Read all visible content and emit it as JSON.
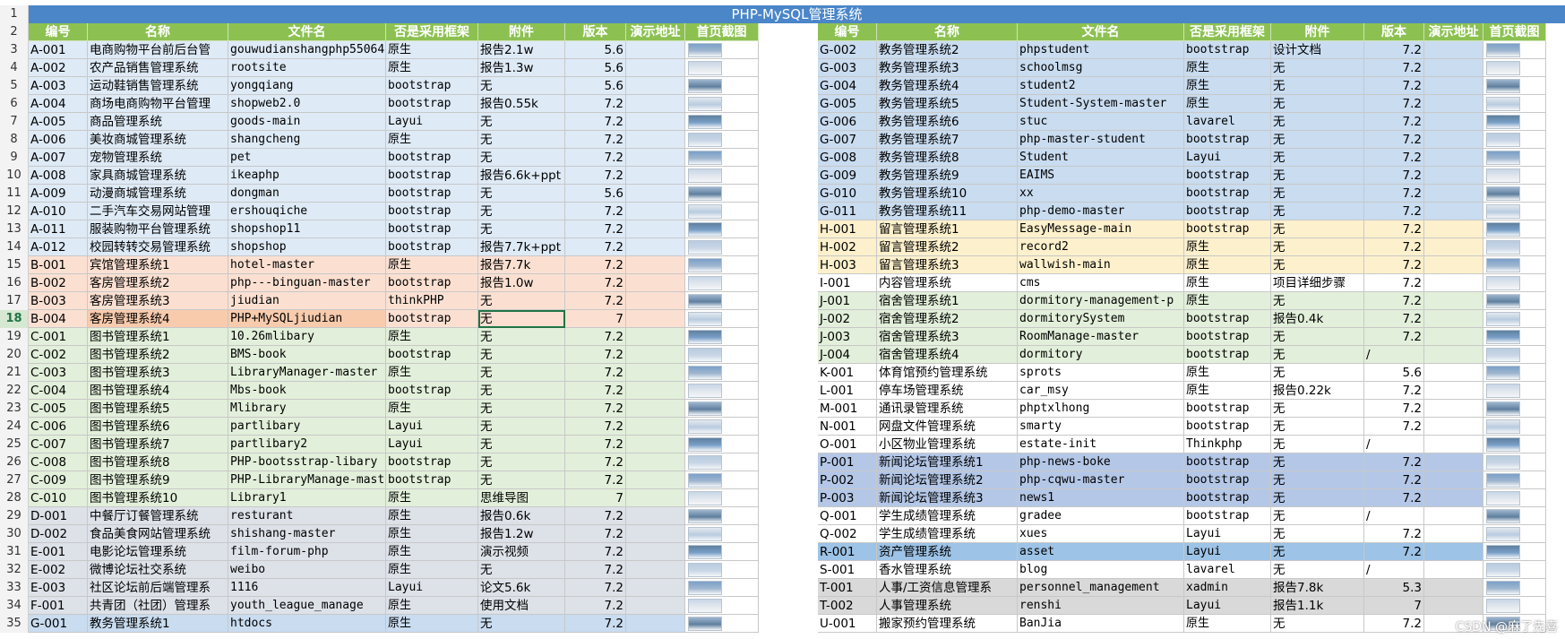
{
  "banner": "PHP-MySQL管理系统",
  "headers": [
    "编号",
    "名称",
    "文件名",
    "否是采用框架",
    "附件",
    "版本",
    "演示地址",
    "首页截图"
  ],
  "colors": {
    "header_green": "#8cc152",
    "banner_blue": "#4a86c8",
    "A": "#deeaf6",
    "B": "#fbe0d2",
    "C": "#e2efda",
    "D": "#dde1e8",
    "G": "#c9dcf0",
    "H": "#fdf0cc",
    "J": "#e2efda",
    "P": "#b4c7e7",
    "R": "#9dc3e6",
    "T": "#d9d9d9",
    "plain": "#ffffff"
  },
  "left_rows": [
    {
      "row": "3",
      "id": "A-001",
      "name": "电商购物平台前后台管",
      "file": "gouwudianshangphp55064",
      "fw": "原生",
      "att": "报告2.1w",
      "ver": "5.6",
      "g": "A"
    },
    {
      "row": "4",
      "id": "A-002",
      "name": "农产品销售管理系统",
      "file": "rootsite",
      "fw": "原生",
      "att": "报告1.3w",
      "ver": "5.6",
      "g": "A"
    },
    {
      "row": "5",
      "id": "A-003",
      "name": "运动鞋销售管理系统",
      "file": "yongqiang",
      "fw": "bootstrap",
      "att": "无",
      "ver": "5.6",
      "g": "A"
    },
    {
      "row": "6",
      "id": "A-004",
      "name": "商场电商购物平台管理",
      "file": "shopweb2.0",
      "fw": "bootstrap",
      "att": "报告0.55k",
      "ver": "7.2",
      "g": "A"
    },
    {
      "row": "7",
      "id": "A-005",
      "name": "商品管理系统",
      "file": "goods-main",
      "fw": "Layui",
      "att": "无",
      "ver": "7.2",
      "g": "A"
    },
    {
      "row": "8",
      "id": "A-006",
      "name": "美妆商城管理系统",
      "file": "shangcheng",
      "fw": "原生",
      "att": "无",
      "ver": "7.2",
      "g": "A"
    },
    {
      "row": "9",
      "id": "A-007",
      "name": "宠物管理系统",
      "file": "pet",
      "fw": "bootstrap",
      "att": "无",
      "ver": "7.2",
      "g": "A"
    },
    {
      "row": "10",
      "id": "A-008",
      "name": "家具商城管理系统",
      "file": "ikeaphp",
      "fw": "bootstrap",
      "att": "报告6.6k+ppt",
      "ver": "7.2",
      "g": "A"
    },
    {
      "row": "11",
      "id": "A-009",
      "name": "动漫商城管理系统",
      "file": "dongman",
      "fw": "bootstrap",
      "att": "无",
      "ver": "5.6",
      "g": "A"
    },
    {
      "row": "12",
      "id": "A-010",
      "name": "二手汽车交易网站管理",
      "file": "ershouqiche",
      "fw": "bootstrap",
      "att": "无",
      "ver": "7.2",
      "g": "A"
    },
    {
      "row": "13",
      "id": "A-011",
      "name": "服装购物平台管理系统",
      "file": "shopshop11",
      "fw": "bootstrap",
      "att": "无",
      "ver": "7.2",
      "g": "A"
    },
    {
      "row": "14",
      "id": "A-012",
      "name": "校园转转交易管理系统",
      "file": "shopshop",
      "fw": "bootstrap",
      "att": "报告7.7k+ppt",
      "ver": "7.2",
      "g": "A"
    },
    {
      "row": "15",
      "id": "B-001",
      "name": "宾馆管理系统1",
      "file": "hotel-master",
      "fw": "原生",
      "att": "报告7.7k",
      "ver": "7.2",
      "g": "B"
    },
    {
      "row": "16",
      "id": "B-002",
      "name": "客房管理系统2",
      "file": "php---binguan-master",
      "fw": "bootstrap",
      "att": "报告1.0w",
      "ver": "7.2",
      "g": "B"
    },
    {
      "row": "17",
      "id": "B-003",
      "name": "客房管理系统3",
      "file": "jiudian",
      "fw": "thinkPHP",
      "att": "无",
      "ver": "7.2",
      "g": "B"
    },
    {
      "row": "18",
      "id": "B-004",
      "name": "客房管理系统4",
      "file": "PHP+MySQLjiudian",
      "fw": "bootstrap",
      "att": "无",
      "ver": "7",
      "g": "B"
    },
    {
      "row": "19",
      "id": "C-001",
      "name": "图书管理系统1",
      "file": "10.26mlibary",
      "fw": "原生",
      "att": "无",
      "ver": "7.2",
      "g": "C"
    },
    {
      "row": "20",
      "id": "C-002",
      "name": "图书管理系统2",
      "file": "BMS-book",
      "fw": "bootstrap",
      "att": "无",
      "ver": "7.2",
      "g": "C"
    },
    {
      "row": "21",
      "id": "C-003",
      "name": "图书管理系统3",
      "file": "LibraryManager-master",
      "fw": "原生",
      "att": "无",
      "ver": "7.2",
      "g": "C"
    },
    {
      "row": "22",
      "id": "C-004",
      "name": "图书管理系统4",
      "file": "Mbs-book",
      "fw": "bootstrap",
      "att": "无",
      "ver": "7.2",
      "g": "C"
    },
    {
      "row": "23",
      "id": "C-005",
      "name": "图书管理系统5",
      "file": "Mlibrary",
      "fw": "原生",
      "att": "无",
      "ver": "7.2",
      "g": "C"
    },
    {
      "row": "24",
      "id": "C-006",
      "name": "图书管理系统6",
      "file": "partlibary",
      "fw": "Layui",
      "att": "无",
      "ver": "7.2",
      "g": "C"
    },
    {
      "row": "25",
      "id": "C-007",
      "name": "图书管理系统7",
      "file": "partlibary2",
      "fw": "Layui",
      "att": "无",
      "ver": "7.2",
      "g": "C"
    },
    {
      "row": "26",
      "id": "C-008",
      "name": "图书管理系统8",
      "file": "PHP-bootsstrap-libary",
      "fw": "bootstrap",
      "att": "无",
      "ver": "7.2",
      "g": "C"
    },
    {
      "row": "27",
      "id": "C-009",
      "name": "图书管理系统9",
      "file": "PHP-LibraryManage-mast",
      "fw": "bootstrap",
      "att": "无",
      "ver": "7.2",
      "g": "C"
    },
    {
      "row": "28",
      "id": "C-010",
      "name": "图书管理系统10",
      "file": "Library1",
      "fw": "原生",
      "att": "思维导图",
      "ver": "7",
      "g": "C"
    },
    {
      "row": "29",
      "id": "D-001",
      "name": "中餐厅订餐管理系统",
      "file": "resturant",
      "fw": "原生",
      "att": "报告0.6k",
      "ver": "7.2",
      "g": "D"
    },
    {
      "row": "30",
      "id": "D-002",
      "name": "食品美食网站管理系统",
      "file": "shishang-master",
      "fw": "原生",
      "att": "报告1.2w",
      "ver": "7.2",
      "g": "D"
    },
    {
      "row": "31",
      "id": "E-001",
      "name": "电影论坛管理系统",
      "file": "film-forum-php",
      "fw": "原生",
      "att": "演示视频",
      "ver": "7.2",
      "g": "D"
    },
    {
      "row": "32",
      "id": "E-002",
      "name": "微博论坛社交系统",
      "file": "weibo",
      "fw": "原生",
      "att": "无",
      "ver": "7.2",
      "g": "D"
    },
    {
      "row": "33",
      "id": "E-003",
      "name": "社区论坛前后端管理系",
      "file": "1116",
      "fw": "Layui",
      "att": "论文5.6k",
      "ver": "7.2",
      "g": "D"
    },
    {
      "row": "34",
      "id": "F-001",
      "name": "共青团（社团）管理系",
      "file": "youth_league_manage",
      "fw": "原生",
      "att": "使用文档",
      "ver": "7.2",
      "g": "D"
    },
    {
      "row": "35",
      "id": "G-001",
      "name": "教务管理系统1",
      "file": "htdocs",
      "fw": "原生",
      "att": "无",
      "ver": "7.2",
      "g": "G"
    }
  ],
  "right_rows": [
    {
      "id": "G-002",
      "name": "教务管理系统2",
      "file": "phpstudent",
      "fw": "bootstrap",
      "att": "设计文档",
      "ver": "7.2",
      "g": "G"
    },
    {
      "id": "G-003",
      "name": "教务管理系统3",
      "file": "schoolmsg",
      "fw": "原生",
      "att": "无",
      "ver": "7.2",
      "g": "G"
    },
    {
      "id": "G-004",
      "name": "教务管理系统4",
      "file": "student2",
      "fw": "原生",
      "att": "无",
      "ver": "7.2",
      "g": "G"
    },
    {
      "id": "G-005",
      "name": "教务管理系统5",
      "file": "Student-System-master",
      "fw": "原生",
      "att": "无",
      "ver": "7.2",
      "g": "G"
    },
    {
      "id": "G-006",
      "name": "教务管理系统6",
      "file": "stuc",
      "fw": "lavarel",
      "att": "无",
      "ver": "7.2",
      "g": "G"
    },
    {
      "id": "G-007",
      "name": "教务管理系统7",
      "file": "php-master-student",
      "fw": "bootstrap",
      "att": "无",
      "ver": "7.2",
      "g": "G"
    },
    {
      "id": "G-008",
      "name": "教务管理系统8",
      "file": "Student",
      "fw": "Layui",
      "att": "无",
      "ver": "7.2",
      "g": "G"
    },
    {
      "id": "G-009",
      "name": "教务管理系统9",
      "file": "EAIMS",
      "fw": "bootstrap",
      "att": "无",
      "ver": "7.2",
      "g": "G"
    },
    {
      "id": "G-010",
      "name": "教务管理系统10",
      "file": "xx",
      "fw": "bootstrap",
      "att": "无",
      "ver": "7.2",
      "g": "G"
    },
    {
      "id": "G-011",
      "name": "教务管理系统11",
      "file": "php-demo-master",
      "fw": "bootstrap",
      "att": "无",
      "ver": "7.2",
      "g": "G"
    },
    {
      "id": "H-001",
      "name": "留言管理系统1",
      "file": "EasyMessage-main",
      "fw": "bootstrap",
      "att": "无",
      "ver": "7.2",
      "g": "H"
    },
    {
      "id": "H-002",
      "name": "留言管理系统2",
      "file": "record2",
      "fw": "原生",
      "att": "无",
      "ver": "7.2",
      "g": "H"
    },
    {
      "id": "H-003",
      "name": "留言管理系统3",
      "file": "wallwish-main",
      "fw": "原生",
      "att": "无",
      "ver": "7.2",
      "g": "H"
    },
    {
      "id": "I-001",
      "name": "内容管理系统",
      "file": "cms",
      "fw": "原生",
      "att": "项目详细步骤",
      "ver": "7.2",
      "g": "plain"
    },
    {
      "id": "J-001",
      "name": "宿舍管理系统1",
      "file": "dormitory-management-p",
      "fw": "原生",
      "att": "无",
      "ver": "7.2",
      "g": "J"
    },
    {
      "id": "J-002",
      "name": "宿舍管理系统2",
      "file": "dormitorySystem",
      "fw": "bootstrap",
      "att": "报告0.4k",
      "ver": "7.2",
      "g": "J"
    },
    {
      "id": "J-003",
      "name": "宿舍管理系统3",
      "file": "RoomManage-master",
      "fw": "bootstrap",
      "att": "无",
      "ver": "7.2",
      "g": "J"
    },
    {
      "id": "J-004",
      "name": "宿舍管理系统4",
      "file": "dormitory",
      "fw": "bootstrap",
      "att": "无",
      "ver": "/",
      "g": "J"
    },
    {
      "id": "K-001",
      "name": "体育馆预约管理系统",
      "file": "sprots",
      "fw": "原生",
      "att": "无",
      "ver": "5.6",
      "g": "plain"
    },
    {
      "id": "L-001",
      "name": "停车场管理系统",
      "file": "car_msy",
      "fw": "原生",
      "att": "报告0.22k",
      "ver": "7.2",
      "g": "plain"
    },
    {
      "id": "M-001",
      "name": "通讯录管理系统",
      "file": "phptxlhong",
      "fw": "bootstrap",
      "att": "无",
      "ver": "7.2",
      "g": "plain"
    },
    {
      "id": "N-001",
      "name": "网盘文件管理系统",
      "file": "smarty",
      "fw": "bootstrap",
      "att": "无",
      "ver": "7.2",
      "g": "plain"
    },
    {
      "id": "O-001",
      "name": "小区物业管理系统",
      "file": "estate-init",
      "fw": "Thinkphp",
      "att": "无",
      "ver": "/",
      "g": "plain"
    },
    {
      "id": "P-001",
      "name": "新闻论坛管理系统1",
      "file": "php-news-boke",
      "fw": "bootstrap",
      "att": "无",
      "ver": "7.2",
      "g": "P"
    },
    {
      "id": "P-002",
      "name": "新闻论坛管理系统2",
      "file": "php-cqwu-master",
      "fw": "bootstrap",
      "att": "无",
      "ver": "7.2",
      "g": "P"
    },
    {
      "id": "P-003",
      "name": "新闻论坛管理系统3",
      "file": "news1",
      "fw": "bootstrap",
      "att": "无",
      "ver": "7.2",
      "g": "P"
    },
    {
      "id": "Q-001",
      "name": "学生成绩管理系统",
      "file": "gradee",
      "fw": "bootstrap",
      "att": "无",
      "ver": "/",
      "g": "plain"
    },
    {
      "id": "Q-002",
      "name": "学生成绩管理系统",
      "file": "xues",
      "fw": "Layui",
      "att": "无",
      "ver": "7.2",
      "g": "plain"
    },
    {
      "id": "R-001",
      "name": "资产管理系统",
      "file": "asset",
      "fw": "Layui",
      "att": "无",
      "ver": "7.2",
      "g": "R"
    },
    {
      "id": "S-001",
      "name": "香水管理系统",
      "file": "blog",
      "fw": "lavarel",
      "att": "无",
      "ver": "/",
      "g": "plain"
    },
    {
      "id": "T-001",
      "name": "人事/工资信息管理系",
      "file": "personnel_management",
      "fw": "xadmin",
      "att": "报告7.8k",
      "ver": "5.3",
      "g": "T"
    },
    {
      "id": "T-002",
      "name": "人事管理系统",
      "file": "renshi",
      "fw": "Layui",
      "att": "报告1.1k",
      "ver": "7",
      "g": "T"
    },
    {
      "id": "U-001",
      "name": "搬家预约管理系统",
      "file": "BanJia",
      "fw": "原生",
      "att": "无",
      "ver": "7.2",
      "g": "plain"
    }
  ],
  "watermark": "CSDN @麻了先喜",
  "row_labels": [
    "1",
    "2"
  ]
}
